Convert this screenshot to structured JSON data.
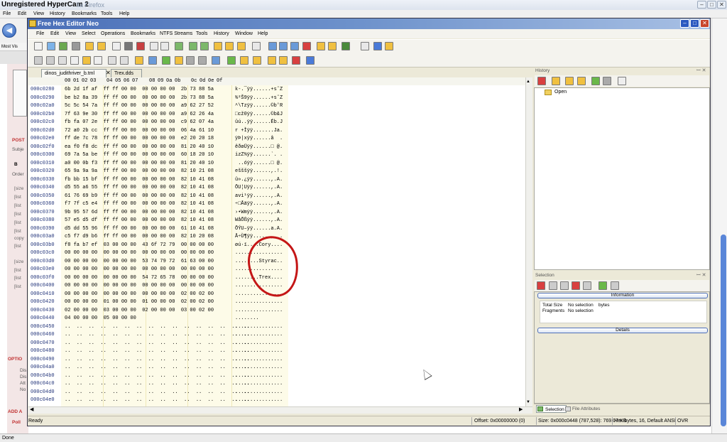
{
  "recorder": {
    "watermark": "Unregistered HyperCam 2"
  },
  "firefox": {
    "title_suffix": "lla Firefox",
    "menu": [
      "File",
      "Edit",
      "View",
      "History",
      "Bookmarks",
      "Tools",
      "Help"
    ],
    "bookmark": "Most Vis",
    "status": "Done",
    "sidebar_texts": [
      "POST",
      "Subje",
      "B",
      "Order",
      "[size",
      "[list",
      "[list",
      "[list",
      "[list",
      "[list",
      "copy",
      "[list",
      "[size",
      "[list",
      "[list",
      "[list",
      "OPTIO",
      "Dis",
      "Dis",
      "Att",
      "No",
      "ADD A",
      "Poll"
    ]
  },
  "app": {
    "title": "Free Hex Editor Neo",
    "menu": [
      "File",
      "Edit",
      "View",
      "Select",
      "Operations",
      "Bookmarks",
      "NTFS Streams",
      "Tools",
      "History",
      "Window",
      "Help"
    ],
    "tabs": [
      "dinos_judithriver_b.tml",
      "Trex.dds"
    ],
    "close_glyph": "✕",
    "column_header": [
      "00",
      "01",
      "02",
      "03",
      "04",
      "05",
      "06",
      "07",
      "08",
      "09",
      "0a",
      "0b",
      "0c",
      "0d",
      "0e",
      "0f"
    ],
    "rows": [
      {
        "addr": "000c0280",
        "hex": "6b 2d 1f af  ff ff 00 00  00 00 00 00  2b 73 88 5a",
        "text": "k-.¯ÿÿ......+s˘Z"
      },
      {
        "addr": "000c0290",
        "hex": "be b2 8a 39  ff ff 00 00  00 00 00 00  2b 73 88 5a",
        "text": "¾²Š9ÿÿ......+s˘Z"
      },
      {
        "addr": "000c02a0",
        "hex": "5c 5c 54 7a  ff ff 00 00  00 00 00 00  a9 62 27 52",
        "text": "^\\Tzÿÿ......©b'R"
      },
      {
        "addr": "000c02b0",
        "hex": "7f 63 9e 30  ff ff 00 00  00 00 00 00  a9 62 26 4a",
        "text": "□cž0ÿÿ......©b&J"
      },
      {
        "addr": "000c02c0",
        "hex": "fb fa 07 2e  ff ff 00 00  00 00 00 00  c9 62 07 4a",
        "text": "ûú..ÿÿ......Éb.J"
      },
      {
        "addr": "000c02d0",
        "hex": "72 a0 2b cc  ff ff 00 00  00 00 00 00  06 4a 61 10",
        "text": "r +Ìÿÿ.......Ja."
      },
      {
        "addr": "000c02e0",
        "hex": "ff de 7c 78  ff ff 00 00  00 00 00 00  e2 20 20 18",
        "text": "ÿÞ|xÿÿ......â  ."
      },
      {
        "addr": "000c02f0",
        "hex": "ea f0 f8 dc  ff ff 00 00  00 00 00 00  81 20 40 10",
        "text": "êðøÜÿÿ......□ @."
      },
      {
        "addr": "000c0300",
        "hex": "69 7a 5a be  ff ff 00 00  00 00 00 00  60 18 20 10",
        "text": "izZ¾ÿÿ......`. ."
      },
      {
        "addr": "000c0310",
        "hex": "a0 00 0b f3  ff ff 00 00  00 00 00 00  81 20 40 10",
        "text": " ..óÿÿ......□ @."
      },
      {
        "addr": "000c0320",
        "hex": "65 9a 9a 9a  ff ff 00 00  00 00 00 00  82 10 21 08",
        "text": "ešššÿÿ......,.!."
      },
      {
        "addr": "000c0330",
        "hex": "fb bb 15 bf  ff ff 00 00  00 00 00 00  82 10 41 08",
        "text": "û».¿ÿÿ......,.A."
      },
      {
        "addr": "000c0340",
        "hex": "d5 55 a6 55  ff ff 00 00  00 00 00 00  82 10 41 08",
        "text": "ÕU¦Uÿÿ......,.A."
      },
      {
        "addr": "000c0350",
        "hex": "61 76 69 b9  ff ff 00 00  00 00 00 00  82 10 41 08",
        "text": "avi¹ÿÿ......,.A."
      },
      {
        "addr": "000c0360",
        "hex": "f7 7f c5 e4  ff ff 00 00  00 00 00 00  82 10 41 08",
        "text": "÷□Åäÿÿ......,.A."
      },
      {
        "addr": "000c0370",
        "hex": "9b 95 57 6d  ff ff 00 00  00 00 00 00  82 10 41 08",
        "text": "›•Wmÿÿ......,.A."
      },
      {
        "addr": "000c0380",
        "hex": "57 e5 d5 df  ff ff 00 00  00 00 00 00  82 10 41 08",
        "text": "WåÕßÿÿ......,.A."
      },
      {
        "addr": "000c0390",
        "hex": "d5 dd 55 96  ff ff 00 00  00 00 00 00  61 10 41 08",
        "text": "ÕÝU–ÿÿ......a.A."
      },
      {
        "addr": "000c03a0",
        "hex": "c5 f7 d9 b6  ff ff 00 00  00 00 00 00  82 10 20 08",
        "text": "Å÷Ù¶ÿÿ......,. ."
      },
      {
        "addr": "000c03b0",
        "hex": "f8 fa b7 ef  03 00 00 00  43 6f 72 79  00 00 00 00",
        "text": "øú·ï....Cory...."
      },
      {
        "addr": "000c03c0",
        "hex": "00 00 00 00  00 00 00 00  00 00 00 00  00 00 00 00",
        "text": "................"
      },
      {
        "addr": "000c03d0",
        "hex": "00 00 00 00  00 00 00 00  53 74 79 72  61 63 00 00",
        "text": "........Styrac.."
      },
      {
        "addr": "000c03e0",
        "hex": "00 00 00 00  00 00 00 00  00 00 00 00  00 00 00 00",
        "text": "................"
      },
      {
        "addr": "000c03f0",
        "hex": "00 00 00 00  00 00 00 00  54 72 65 78  00 00 00 00",
        "text": "........Trex...."
      },
      {
        "addr": "000c0400",
        "hex": "00 00 00 00  00 00 00 00  00 00 00 00  00 00 00 00",
        "text": "................"
      },
      {
        "addr": "000c0410",
        "hex": "00 00 00 00  00 00 00 00  00 00 00 00  02 00 02 00",
        "text": "................"
      },
      {
        "addr": "000c0420",
        "hex": "00 00 00 00  01 00 00 00  01 00 00 00  02 00 02 00",
        "text": "................"
      },
      {
        "addr": "000c0430",
        "hex": "02 00 00 00  03 00 00 00  02 00 00 00  03 00 02 00",
        "text": "................"
      },
      {
        "addr": "000c0440",
        "hex": "04 00 00 00  05 00 00 00",
        "text": "........"
      },
      {
        "addr": "000c0450",
        "hex": "..  ..  ..  ..  ..  ..  ..  ..  ..  ..  ..  ..  ..  ..  ..  ..",
        "text": "................"
      },
      {
        "addr": "000c0460",
        "hex": "..  ..  ..  ..  ..  ..  ..  ..  ..  ..  ..  ..  ..  ..  ..  ..",
        "text": "................"
      },
      {
        "addr": "000c0470",
        "hex": "..  ..  ..  ..  ..  ..  ..  ..  ..  ..  ..  ..  ..  ..  ..  ..",
        "text": "................"
      },
      {
        "addr": "000c0480",
        "hex": "..  ..  ..  ..  ..  ..  ..  ..  ..  ..  ..  ..  ..  ..  ..  ..",
        "text": "................"
      },
      {
        "addr": "000c0490",
        "hex": "..  ..  ..  ..  ..  ..  ..  ..  ..  ..  ..  ..  ..  ..  ..  ..",
        "text": "................"
      },
      {
        "addr": "000c04a0",
        "hex": "..  ..  ..  ..  ..  ..  ..  ..  ..  ..  ..  ..  ..  ..  ..  ..",
        "text": "................"
      },
      {
        "addr": "000c04b0",
        "hex": "..  ..  ..  ..  ..  ..  ..  ..  ..  ..  ..  ..  ..  ..  ..  ..",
        "text": "................"
      },
      {
        "addr": "000c04c0",
        "hex": "..  ..  ..  ..  ..  ..  ..  ..  ..  ..  ..  ..  ..  ..  ..  ..",
        "text": "................"
      },
      {
        "addr": "000c04d0",
        "hex": "..  ..  ..  ..  ..  ..  ..  ..  ..  ..  ..  ..  ..  ..  ..  ..",
        "text": "................"
      },
      {
        "addr": "000c04e0",
        "hex": "..  ..  ..  ..  ..  ..  ..  ..  ..  ..  ..  ..  ..  ..  ..  ..",
        "text": "................"
      }
    ],
    "history": {
      "header": "History",
      "item": "Open"
    },
    "selection": {
      "header": "Selection",
      "information": "Information",
      "total_size_label": "Total Size",
      "total_size_value": "No selection",
      "total_size_unit": "bytes",
      "fragments_label": "Fragments",
      "fragments_value": "No selection",
      "details": "Details"
    },
    "bottom_tabs": [
      "Selection",
      "File Attributes"
    ],
    "status": {
      "ready": "Ready",
      "offset": "Offset: 0x00000000 (0)",
      "size": "Size: 0x000c0448 (787,528): 769.07 KB",
      "hex_bytes": "Hex bytes, 16, Default ANSI",
      "mode": "OVR"
    }
  },
  "colors": {
    "annotation": "#c41616",
    "title_bar": "#4a6fb8",
    "hex_bg": "#fdfbe8"
  }
}
